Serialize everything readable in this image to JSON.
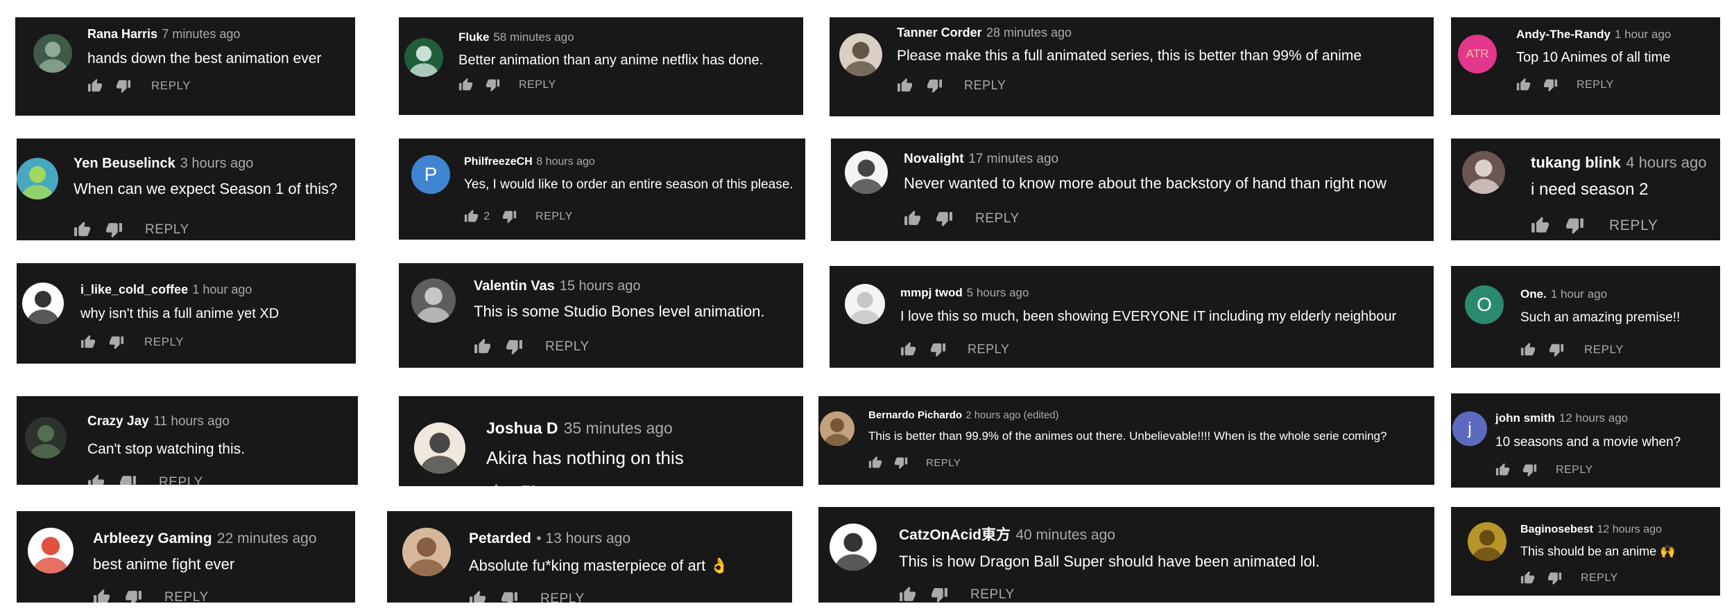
{
  "colors": {
    "card_bg": "#181818",
    "text": "#ffffff",
    "meta": "#aaaaaa"
  },
  "comments": [
    {
      "author": "Rana Harris",
      "time": "7 minutes ago",
      "text": "hands down the best animation ever",
      "reply": "REPLY",
      "avatar": {
        "type": "photo",
        "bg": "#3f5a48",
        "fg": "#9fb8a9"
      }
    },
    {
      "author": "Fluke",
      "time": "58 minutes ago",
      "text": "Better animation than any anime netflix has done.",
      "reply": "REPLY",
      "avatar": {
        "type": "photo",
        "bg": "#1e5e3a",
        "fg": "#e6f6f0"
      }
    },
    {
      "author": "Tanner Corder",
      "time": "28 minutes ago",
      "text": "Please make this a full animated series, this is better than 99% of anime",
      "reply": "REPLY",
      "avatar": {
        "type": "photo",
        "bg": "#d9cfc2",
        "fg": "#4e3e31"
      }
    },
    {
      "author": "Andy-The-Randy",
      "time": "1 hour ago",
      "text": "Top 10 Animes of all time",
      "reply": "REPLY",
      "avatar": {
        "type": "text",
        "letter": "ATR",
        "bg": "#e2378a",
        "fg": "#f7c0a8"
      }
    },
    {
      "author": "Yen Beuselinck",
      "time": "3 hours ago",
      "text": "When can we expect Season 1 of this?",
      "reply": "REPLY",
      "avatar": {
        "type": "photo",
        "bg": "#48a8c0",
        "fg": "#b2e24d"
      }
    },
    {
      "author": "PhilfreezeCH",
      "time": "8 hours ago",
      "text": "Yes, I would like to order an entire season of this please.",
      "likes": "2",
      "reply": "REPLY",
      "avatar": {
        "type": "letter",
        "letter": "P",
        "bg": "#3f85d2",
        "fg": "#ffffff"
      }
    },
    {
      "author": "Novalight",
      "time": "17 minutes ago",
      "text": "Never wanted to know more about the backstory of hand than right now",
      "reply": "REPLY",
      "avatar": {
        "type": "photo",
        "bg": "#f4f4f4",
        "fg": "#262626"
      }
    },
    {
      "author": "tukang blink",
      "time": "4 hours ago",
      "text": "i need season 2",
      "reply": "REPLY",
      "avatar": {
        "type": "photo",
        "bg": "#6a5652",
        "fg": "#efe6e2"
      }
    },
    {
      "author": "i_like_cold_coffee",
      "time": "1 hour ago",
      "text": "why isn't this a full anime yet XD",
      "reply": "REPLY",
      "avatar": {
        "type": "photo",
        "bg": "#ffffff",
        "fg": "#111111"
      }
    },
    {
      "author": "Valentin Vas",
      "time": "15 hours ago",
      "text": "This is some Studio Bones level animation.",
      "reply": "REPLY",
      "avatar": {
        "type": "photo",
        "bg": "#5e5e5e",
        "fg": "#d8d8d8"
      }
    },
    {
      "author": "mmpj twod",
      "time": "5 hours ago",
      "text": "I love this so much, been showing EVERYONE IT including my elderly neighbour",
      "reply": "REPLY",
      "avatar": {
        "type": "photo",
        "bg": "#f4f4f4",
        "fg": "#bdbdbd"
      }
    },
    {
      "author": "One.",
      "time": "1 hour ago",
      "text": "Such an amazing premise!!",
      "reply": "REPLY",
      "avatar": {
        "type": "letter",
        "letter": "O",
        "bg": "#2a8a70",
        "fg": "#ffffff"
      }
    },
    {
      "author": "Crazy Jay",
      "time": "11 hours ago",
      "text": "Can't stop watching this.",
      "reply": "REPLY",
      "avatar": {
        "type": "photo",
        "bg": "#2c332c",
        "fg": "#5b7a58"
      }
    },
    {
      "author": "Joshua D",
      "time": "35 minutes ago",
      "text": "Akira has nothing on this",
      "reply": "REPLY",
      "avatar": {
        "type": "photo",
        "bg": "#efe8dc",
        "fg": "#2b2b2b"
      }
    },
    {
      "author": "Bernardo Pichardo",
      "time": "2 hours ago (edited)",
      "text": "This is better than 99.9%  of the animes out there. Unbelievable!!!! When is the whole serie coming?",
      "reply": "REPLY",
      "avatar": {
        "type": "photo",
        "bg": "#c2a27c",
        "fg": "#6a4a2a"
      }
    },
    {
      "author": "john smith",
      "time": "12 hours ago",
      "text": "10 seasons and a movie when?",
      "reply": "REPLY",
      "avatar": {
        "type": "letter",
        "letter": "j",
        "bg": "#5c6bc0",
        "fg": "#ffffff"
      }
    },
    {
      "author": "Arbleezy Gaming",
      "time": "22 minutes ago",
      "text": "best anime fight ever",
      "reply": "REPLY",
      "avatar": {
        "type": "photo",
        "bg": "#ffffff",
        "fg": "#d9341e"
      }
    },
    {
      "author": "Petarded",
      "time": "• 13 hours ago",
      "text": "Absolute fu*king masterpiece of art 👌",
      "reply": "REPLY",
      "avatar": {
        "type": "photo",
        "bg": "#d7b79a",
        "fg": "#7a5032"
      }
    },
    {
      "author": "CatzOnAcid東方",
      "time": "40 minutes ago",
      "text": "This is how Dragon Ball Super should have been animated lol.",
      "reply": "REPLY",
      "avatar": {
        "type": "photo",
        "bg": "#ffffff",
        "fg": "#111111"
      }
    },
    {
      "author": "Baginosebest",
      "time": "12 hours ago",
      "text": "This should be an anime 🙌",
      "reply": "REPLY",
      "avatar": {
        "type": "photo",
        "bg": "#b8952a",
        "fg": "#5a3e10"
      }
    }
  ]
}
